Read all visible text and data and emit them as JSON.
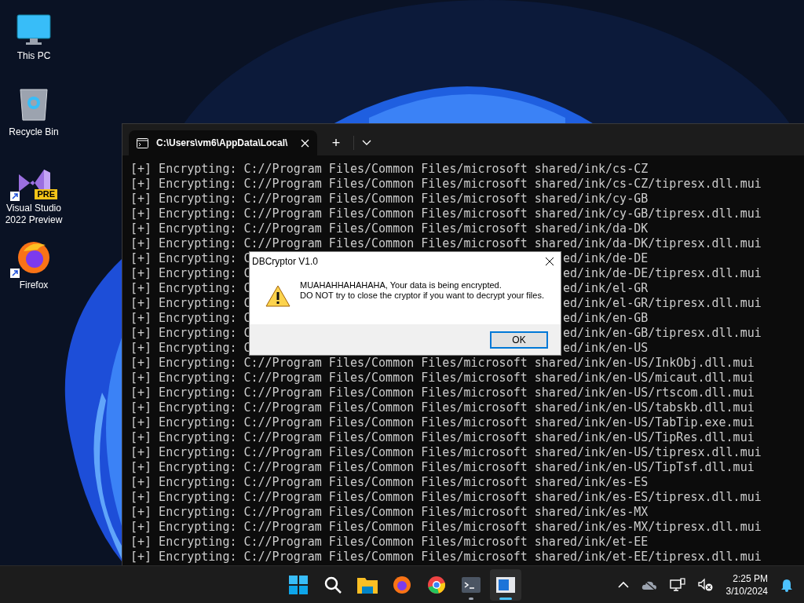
{
  "desktop_icons": [
    {
      "kind": "pc",
      "label": "This PC",
      "shortcut": false
    },
    {
      "kind": "bin",
      "label": "Recycle Bin",
      "shortcut": false
    },
    {
      "kind": "vs",
      "label": "Visual Studio 2022 Preview",
      "badge": "PRE",
      "shortcut": true
    },
    {
      "kind": "firefox",
      "label": "Firefox",
      "shortcut": true
    }
  ],
  "terminal": {
    "tab_title": "C:\\Users\\vm6\\AppData\\Local\\",
    "new_tab": "+",
    "lines": [
      {
        "text": "[+] Encrypting: C://Program Files/Common Files/microsoft shared/ink/cs-CZ"
      },
      {
        "text": "[+] Encrypting: C://Program Files/Common Files/microsoft shared/ink/cs-CZ/tipresx.dll.mui"
      },
      {
        "text": "[+] Encrypting: C://Program Files/Common Files/microsoft shared/ink/cy-GB"
      },
      {
        "text": "[+] Encrypting: C://Program Files/Common Files/microsoft shared/ink/cy-GB/tipresx.dll.mui"
      },
      {
        "text": "[+] Encrypting: C://Program Files/Common Files/microsoft shared/ink/da-DK"
      },
      {
        "text": "[+] Encrypting: C://Program Files/Common Files/microsoft shared/ink/da-DK/tipresx.dll.mui"
      },
      {
        "text": "[+] Encrypting: C",
        "text_right": "ed/ink/de-DE"
      },
      {
        "text": "[+] Encrypting: C",
        "text_right": "ed/ink/de-DE/tipresx.dll.mui"
      },
      {
        "text": "[+] Encrypting: C",
        "text_right": "ed/ink/el-GR"
      },
      {
        "text": "[+] Encrypting: C",
        "text_right": "ed/ink/el-GR/tipresx.dll.mui"
      },
      {
        "text": "[+] Encrypting: C",
        "text_right": "ed/ink/en-GB"
      },
      {
        "text": "[+] Encrypting: C",
        "text_right": "ed/ink/en-GB/tipresx.dll.mui"
      },
      {
        "text": "[+] Encrypting: C",
        "text_right": "ed/ink/en-US"
      },
      {
        "text": "[+] Encrypting: C://Program Files/Common Files/microsoft shared/ink/en-US/InkObj.dll.mui"
      },
      {
        "text": "[+] Encrypting: C://Program Files/Common Files/microsoft shared/ink/en-US/micaut.dll.mui"
      },
      {
        "text": "[+] Encrypting: C://Program Files/Common Files/microsoft shared/ink/en-US/rtscom.dll.mui"
      },
      {
        "text": "[+] Encrypting: C://Program Files/Common Files/microsoft shared/ink/en-US/tabskb.dll.mui"
      },
      {
        "text": "[+] Encrypting: C://Program Files/Common Files/microsoft shared/ink/en-US/TabTip.exe.mui"
      },
      {
        "text": "[+] Encrypting: C://Program Files/Common Files/microsoft shared/ink/en-US/TipRes.dll.mui"
      },
      {
        "text": "[+] Encrypting: C://Program Files/Common Files/microsoft shared/ink/en-US/tipresx.dll.mui"
      },
      {
        "text": "[+] Encrypting: C://Program Files/Common Files/microsoft shared/ink/en-US/TipTsf.dll.mui"
      },
      {
        "text": "[+] Encrypting: C://Program Files/Common Files/microsoft shared/ink/es-ES"
      },
      {
        "text": "[+] Encrypting: C://Program Files/Common Files/microsoft shared/ink/es-ES/tipresx.dll.mui"
      },
      {
        "text": "[+] Encrypting: C://Program Files/Common Files/microsoft shared/ink/es-MX"
      },
      {
        "text": "[+] Encrypting: C://Program Files/Common Files/microsoft shared/ink/es-MX/tipresx.dll.mui"
      },
      {
        "text": "[+] Encrypting: C://Program Files/Common Files/microsoft shared/ink/et-EE"
      },
      {
        "text": "[+] Encrypting: C://Program Files/Common Files/microsoft shared/ink/et-EE/tipresx.dll.mui"
      }
    ]
  },
  "dialog": {
    "title": "DBCryptor V1.0",
    "message_1": "MUAHAHHAHAHAHA, Your data is being encrypted.",
    "message_2": "DO NOT try to close the cryptor if you want to decrypt your files.",
    "button": "OK"
  },
  "taskbar": {
    "apps": [
      {
        "kind": "start",
        "running": false,
        "selected": false
      },
      {
        "kind": "search",
        "running": false,
        "selected": false
      },
      {
        "kind": "explorer",
        "running": false,
        "selected": false
      },
      {
        "kind": "firefox",
        "running": false,
        "selected": false
      },
      {
        "kind": "chrome",
        "running": false,
        "selected": false
      },
      {
        "kind": "terminal",
        "running": true,
        "selected": false
      },
      {
        "kind": "app",
        "running": true,
        "selected": true
      }
    ],
    "tray": [
      {
        "kind": "chevron"
      },
      {
        "kind": "cloud"
      },
      {
        "kind": "network"
      },
      {
        "kind": "volume"
      }
    ],
    "time": "2:25 PM",
    "date": "3/10/2024"
  }
}
